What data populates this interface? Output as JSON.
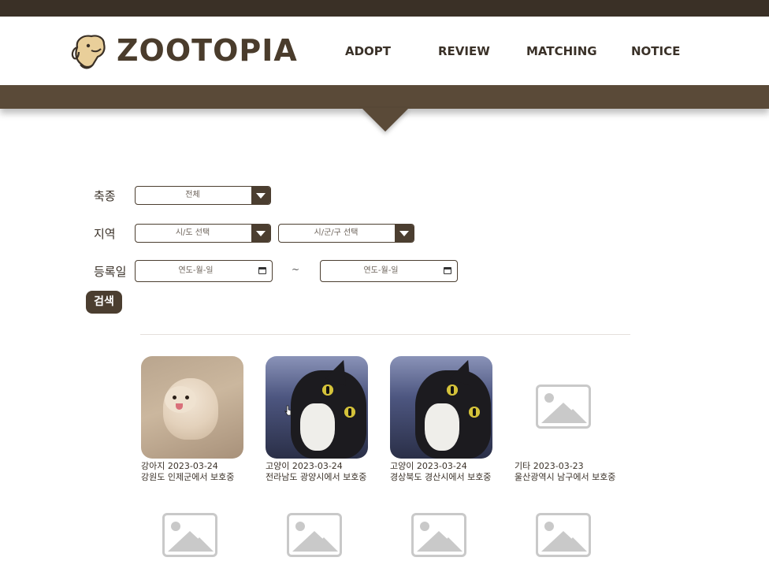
{
  "brand": {
    "name": "ZOOTOPIA",
    "logo_icon": "dog-logo-icon"
  },
  "nav": [
    {
      "label": "ADOPT"
    },
    {
      "label": "REVIEW"
    },
    {
      "label": "MATCHING"
    },
    {
      "label": "NOTICE"
    }
  ],
  "filters": {
    "species": {
      "label": "축종",
      "value": "전체"
    },
    "region": {
      "label": "지역",
      "sido": "시/도 선택",
      "sigungu": "시/군/구 선택"
    },
    "date": {
      "label": "등록일",
      "from": "연도-월-일",
      "separator": "~",
      "to": "연도-월-일"
    },
    "search_label": "검색"
  },
  "cards": [
    {
      "type": "강아지",
      "date": "2023-03-24",
      "location": "강원도 인제군에서 보호중"
    },
    {
      "type": "고양이",
      "date": "2023-03-24",
      "location": "전라남도 광양시에서 보호중"
    },
    {
      "type": "고양이",
      "date": "2023-03-24",
      "location": "경상북도 경산시에서 보호중"
    },
    {
      "type": "기타",
      "date": "2023-03-23",
      "location": "울산광역시 남구에서 보호중"
    }
  ],
  "colors": {
    "brand_dark": "#3a3026",
    "brand_mid": "#5a4a38",
    "control": "#4b3e30"
  }
}
